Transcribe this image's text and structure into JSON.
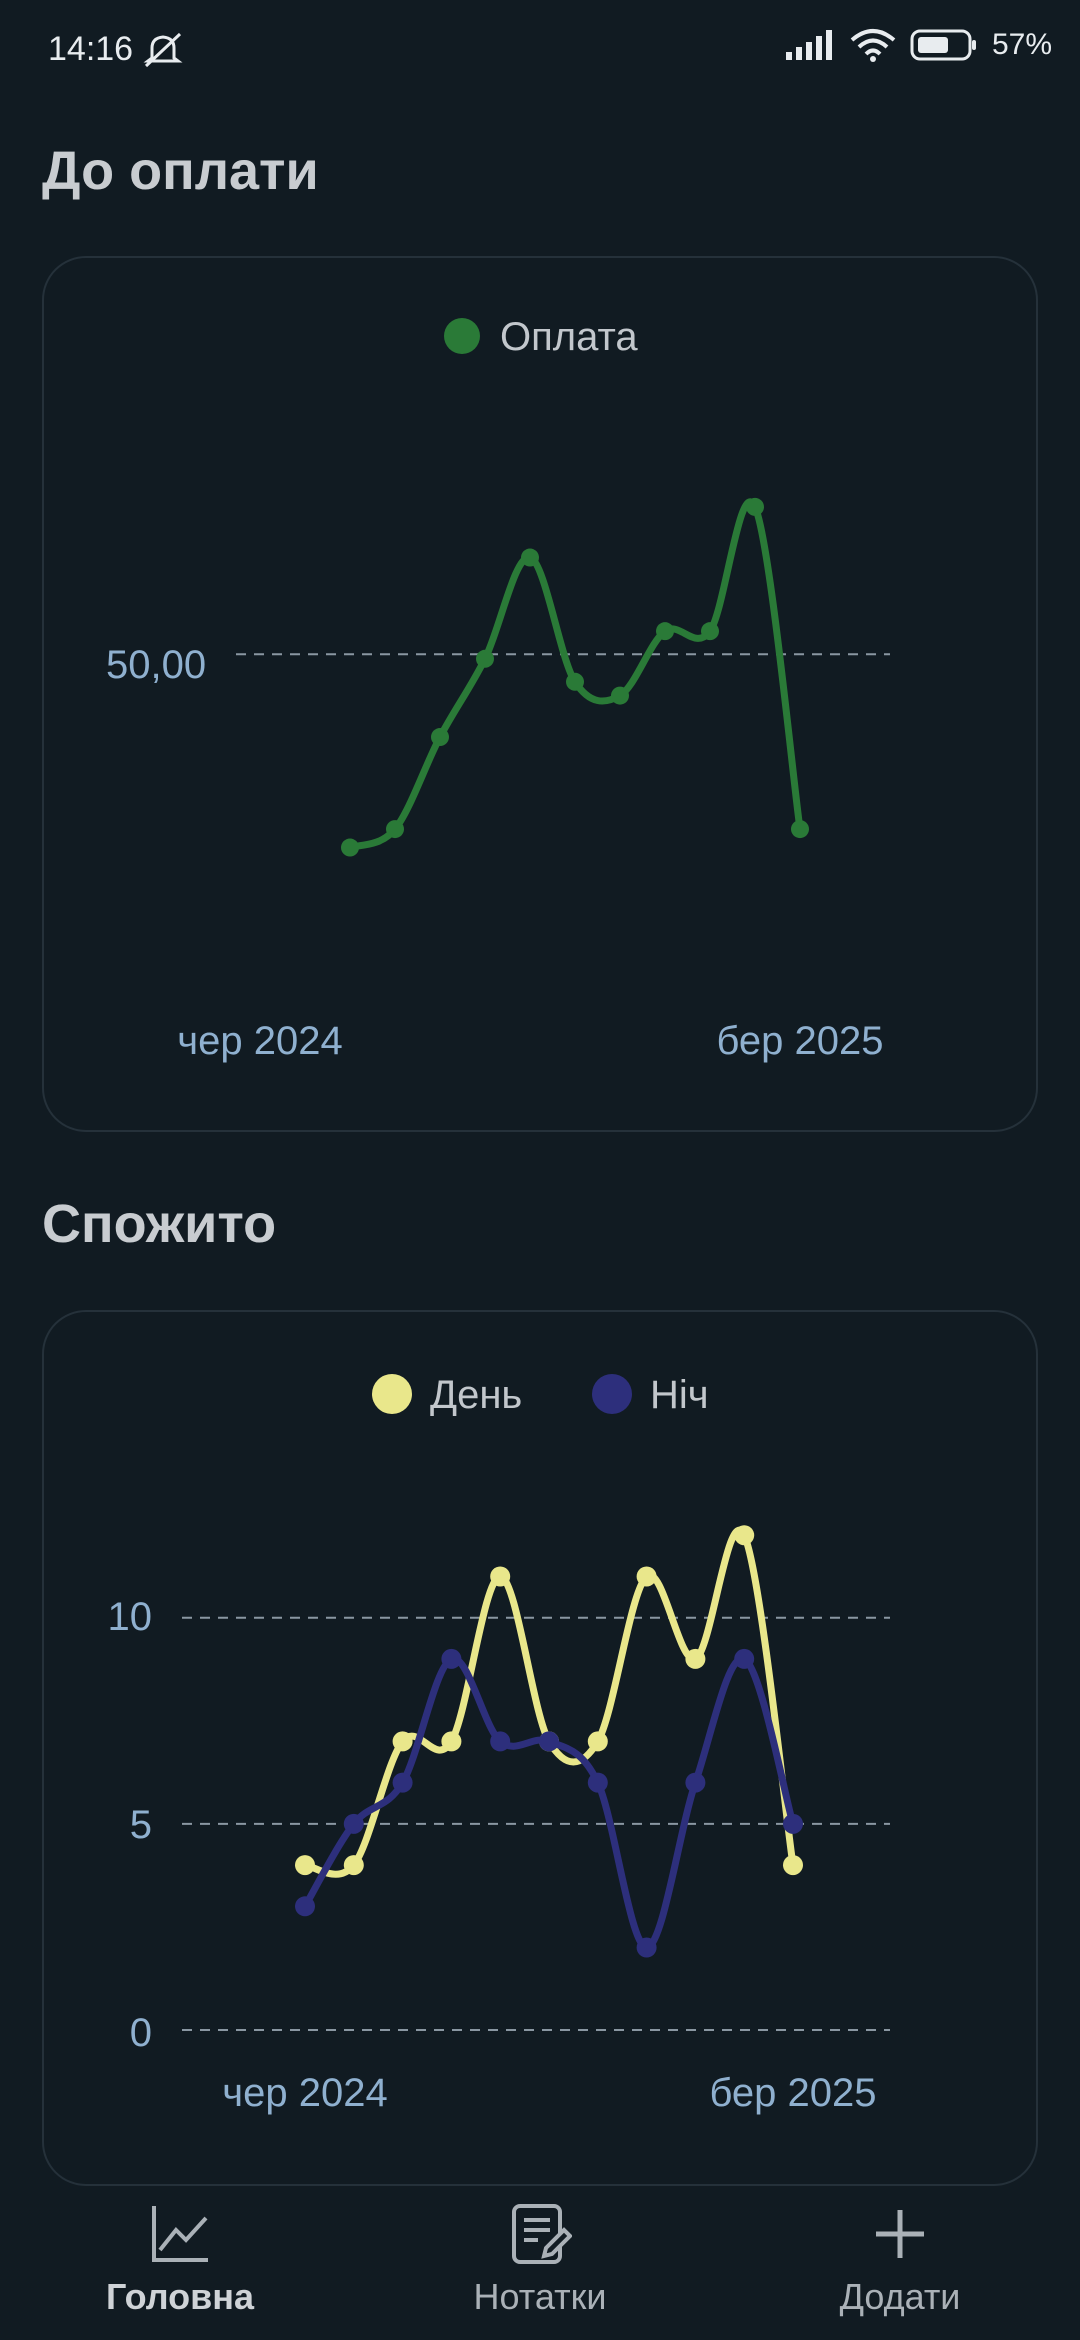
{
  "status": {
    "time": "14:16",
    "battery": "57%"
  },
  "payment_section": {
    "title": "До оплати",
    "chart_data": {
      "type": "line",
      "legend": "top-center",
      "series": [
        {
          "name": "Оплата",
          "color": "#2a7a37",
          "values": [
            29,
            31,
            41,
            49.5,
            60.5,
            47,
            45.5,
            52.5,
            52.5,
            66,
            31
          ]
        }
      ],
      "x_tick_labels": [
        "чер 2024",
        "бер 2025"
      ],
      "y_tick_labels": [
        "50,00"
      ],
      "y_reference": 50,
      "ylim": [
        17,
        80
      ],
      "grid": "dashed horizontal"
    }
  },
  "consumed_section": {
    "title": "Спожито",
    "chart_data": {
      "type": "line",
      "legend": "top-center",
      "series": [
        {
          "name": "День",
          "color": "#e9e78b",
          "values": [
            4,
            4,
            7,
            7,
            11,
            7,
            7,
            11,
            9,
            12,
            4
          ]
        },
        {
          "name": "Ніч",
          "color": "#2d2f7c",
          "values": [
            3,
            5,
            6,
            9,
            7,
            7,
            6,
            2,
            6,
            9,
            5
          ]
        }
      ],
      "x_tick_labels": [
        "чер 2024",
        "бер 2025"
      ],
      "y_tick_labels": [
        "0",
        "5",
        "10"
      ],
      "ylim": [
        0,
        13
      ],
      "grid": "dashed horizontal"
    }
  },
  "nav": {
    "items": [
      {
        "label": "Головна",
        "icon": "chart-icon",
        "active": true
      },
      {
        "label": "Нотатки",
        "icon": "notes-icon",
        "active": false
      },
      {
        "label": "Додати",
        "icon": "plus-icon",
        "active": false
      }
    ]
  }
}
